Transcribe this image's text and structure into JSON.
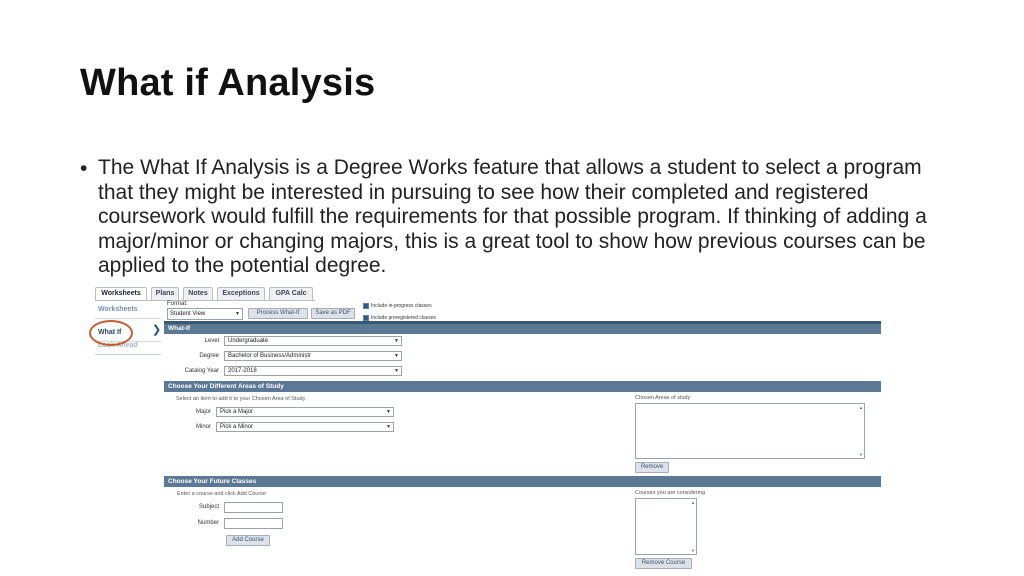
{
  "slide": {
    "title": "What if Analysis",
    "bullet": "The What If Analysis is a Degree Works feature that allows a student to select a program that they might be interested in pursuing to see how their completed and registered coursework would fulfill the requirements for that possible program. If thinking of adding a major/minor or changing majors, this is a great tool to show how previous courses can be applied to the potential degree."
  },
  "degreeworks": {
    "tabs": [
      "Worksheets",
      "Plans",
      "Notes",
      "Exceptions",
      "GPA Calc"
    ],
    "sidenav": [
      "Worksheets",
      "What If",
      "Look Ahead"
    ],
    "format": {
      "label": "Format:",
      "value": "Student View",
      "process_button": "Process What-If",
      "pdf_button": "Save as PDF",
      "include_inprogress": "Include in-progress classes",
      "include_preregistered": "Include preregistered classes"
    },
    "whatif": {
      "title": "What-If",
      "level_label": "Level",
      "level_value": "Undergraduate",
      "degree_label": "Degree",
      "degree_value": "Bachelor of Business/Administr",
      "catalog_label": "Catalog Year",
      "catalog_value": "2017-2018"
    },
    "areas": {
      "title": "Choose Your Different Areas of Study",
      "hint": "Select an item to add it to your Chosen Area of Study",
      "major_label": "Major",
      "major_value": "Pick a Major",
      "minor_label": "Minor",
      "minor_value": "Pick a Minor",
      "chosen_label": "Chosen Areas of study",
      "remove_button": "Remove"
    },
    "future": {
      "title": "Choose Your Future Classes",
      "hint": "Enter a course and click Add Course",
      "subject_label": "Subject",
      "number_label": "Number",
      "add_button": "Add Course",
      "considering_label": "Courses you are considering",
      "remove_button": "Remove Course"
    }
  },
  "colors": {
    "section_bar": "#5b7894",
    "highlight_ring": "#c95c2e",
    "button_bg": "#dde2e8"
  }
}
